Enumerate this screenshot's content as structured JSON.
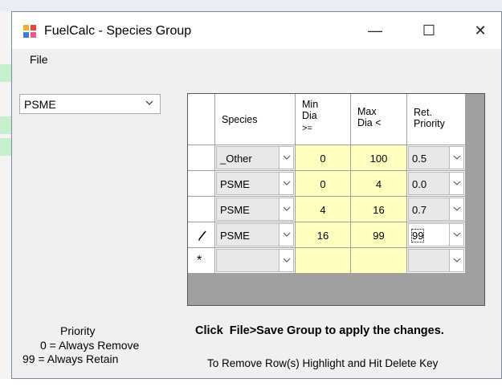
{
  "window": {
    "title": "FuelCalc - Species Group",
    "minimize_glyph": "—",
    "maximize_glyph": "☐",
    "close_glyph": "✕"
  },
  "menu": {
    "file": "File"
  },
  "species_combo": {
    "value": "PSME"
  },
  "grid": {
    "headers": {
      "species": "Species",
      "min_dia": [
        "Min",
        "Dia",
        ">="
      ],
      "max_dia": [
        "Max",
        "Dia <"
      ],
      "ret_priority": [
        "Ret.",
        "Priority"
      ]
    },
    "rows": [
      {
        "species": "_Other",
        "min": "0",
        "max": "100",
        "priority": "0.5",
        "row_marker": ""
      },
      {
        "species": "PSME",
        "min": "0",
        "max": "4",
        "priority": "0.0",
        "row_marker": ""
      },
      {
        "species": "PSME",
        "min": "4",
        "max": "16",
        "priority": "0.7",
        "row_marker": ""
      },
      {
        "species": "PSME",
        "min": "16",
        "max": "99",
        "priority": "99",
        "row_marker": "pencil"
      },
      {
        "species": "",
        "min": "",
        "max": "",
        "priority": "",
        "row_marker": "*"
      }
    ]
  },
  "legend": {
    "title": "Priority",
    "line1": "0 = Always Remove",
    "line2": "99 = Always Retain"
  },
  "messages": {
    "save": "Click  File>Save Group to apply the changes.",
    "remove": "To Remove Row(s) Highlight and Hit Delete Key"
  },
  "colors": {
    "edit_cell": "#ffffc0",
    "grid_bg": "#a0a0a0",
    "dialog_bg": "#f0f0f0"
  }
}
